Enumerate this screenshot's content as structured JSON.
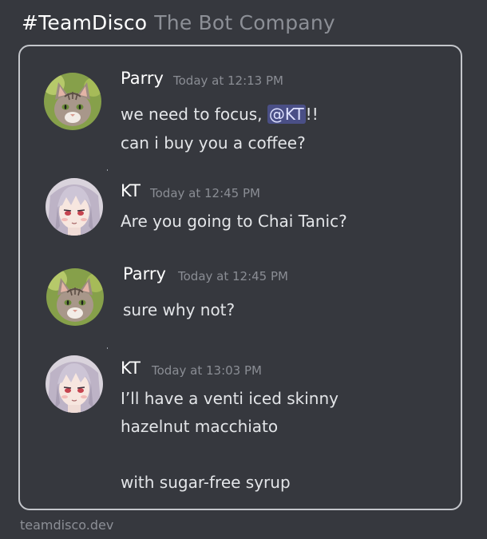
{
  "header": {
    "team": "#TeamDisco",
    "company": "The Bot Company"
  },
  "messages": [
    {
      "author": "Parry",
      "timestamp": "Today at 12:13 PM",
      "avatar": "cat-avatar",
      "lines": [
        {
          "before": "we need to focus, ",
          "mention": "@KT",
          "after": "!!"
        },
        {
          "text": "can i buy you a coffee?"
        }
      ]
    },
    {
      "author": "KT",
      "timestamp": "Today at 12:45 PM",
      "avatar": "anime-girl-avatar",
      "lines": [
        {
          "text": "Are you going to Chai Tanic?"
        }
      ]
    },
    {
      "author": "Parry",
      "timestamp": "Today at 12:45 PM",
      "avatar": "cat-avatar",
      "lines": [
        {
          "text": "sure why not?"
        }
      ]
    },
    {
      "author": "KT",
      "timestamp": "Today at 13:03 PM",
      "avatar": "anime-girl-avatar",
      "lines": [
        {
          "text": "I’ll have a venti iced skinny"
        },
        {
          "text": "hazelnut macchiato"
        },
        {
          "text": "with sugar-free syrup"
        }
      ]
    }
  ],
  "footer": {
    "site": "teamdisco.dev"
  },
  "colors": {
    "background": "#36383e",
    "card_border": "#c4c6cb",
    "mention_bg": "#4a4f86",
    "text": "#e3e5e8",
    "muted": "#8a8d94"
  }
}
